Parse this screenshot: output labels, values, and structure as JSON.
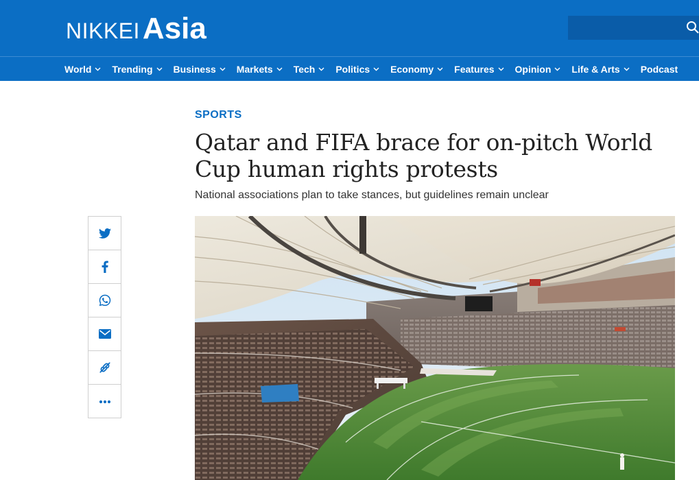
{
  "brand": {
    "nikkei": "NIKKEI",
    "asia": "Asia"
  },
  "search": {
    "icon": "search-icon"
  },
  "nav": {
    "items": [
      {
        "label": "World",
        "dropdown": true
      },
      {
        "label": "Trending",
        "dropdown": true
      },
      {
        "label": "Business",
        "dropdown": true
      },
      {
        "label": "Markets",
        "dropdown": true
      },
      {
        "label": "Tech",
        "dropdown": true
      },
      {
        "label": "Politics",
        "dropdown": true
      },
      {
        "label": "Economy",
        "dropdown": true
      },
      {
        "label": "Features",
        "dropdown": true
      },
      {
        "label": "Opinion",
        "dropdown": true
      },
      {
        "label": "Life & Arts",
        "dropdown": true
      },
      {
        "label": "Podcast",
        "dropdown": false
      }
    ]
  },
  "article": {
    "section": "SPORTS",
    "headline": "Qatar and FIFA brace for on-pitch World Cup human rights protests",
    "subhead": "National associations plan to take stances, but guidelines remain unclear"
  },
  "share": {
    "buttons": [
      {
        "icon": "twitter-icon"
      },
      {
        "icon": "facebook-icon"
      },
      {
        "icon": "whatsapp-icon"
      },
      {
        "icon": "email-icon"
      },
      {
        "icon": "link-icon"
      },
      {
        "icon": "more-icon"
      }
    ]
  },
  "colors": {
    "brand_blue": "#0b6ec4",
    "header_dark": "#0a5ca8",
    "pitch_green": "#4f8a3a"
  }
}
